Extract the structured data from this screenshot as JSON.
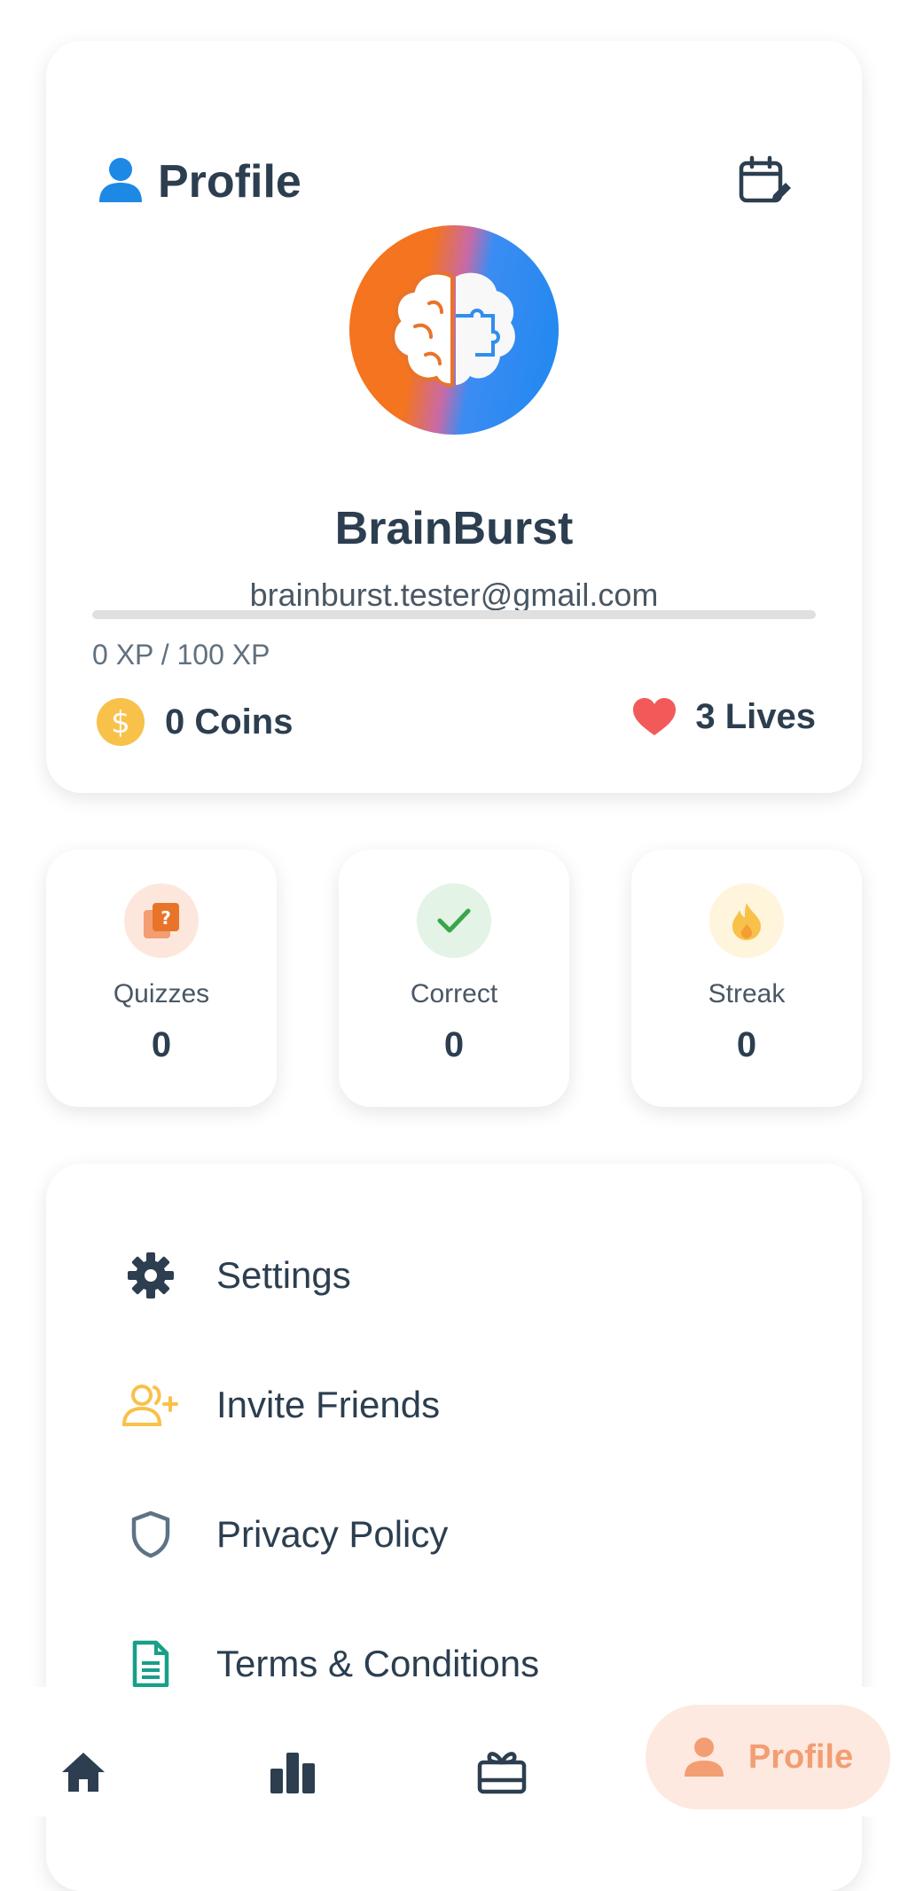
{
  "header": {
    "title": "Profile"
  },
  "user": {
    "name": "BrainBurst",
    "email": "brainburst.tester@gmail.com",
    "xp_text": "0 XP / 100 XP",
    "xp_progress": 0,
    "coins_text": "0 Coins",
    "lives_text": "3 Lives"
  },
  "stats": [
    {
      "label": "Quizzes",
      "value": "0",
      "icon": "quiz-icon"
    },
    {
      "label": "Correct",
      "value": "0",
      "icon": "check-icon"
    },
    {
      "label": "Streak",
      "value": "0",
      "icon": "fire-icon"
    }
  ],
  "menu": [
    {
      "label": "Settings",
      "icon": "gear-icon"
    },
    {
      "label": "Invite Friends",
      "icon": "add-user-icon"
    },
    {
      "label": "Privacy Policy",
      "icon": "shield-icon"
    },
    {
      "label": "Terms & Conditions",
      "icon": "document-icon"
    }
  ],
  "nav": {
    "items": [
      "home-icon",
      "leaderboard-icon",
      "rewards-icon",
      "profile-icon"
    ],
    "active_label": "Profile"
  },
  "colors": {
    "text": "#2c3e50",
    "accent": "#f4741f",
    "coin": "#f8c14a",
    "heart": "#f25a5a",
    "check": "#3aa64a",
    "nav_active_bg": "#fde9df"
  }
}
